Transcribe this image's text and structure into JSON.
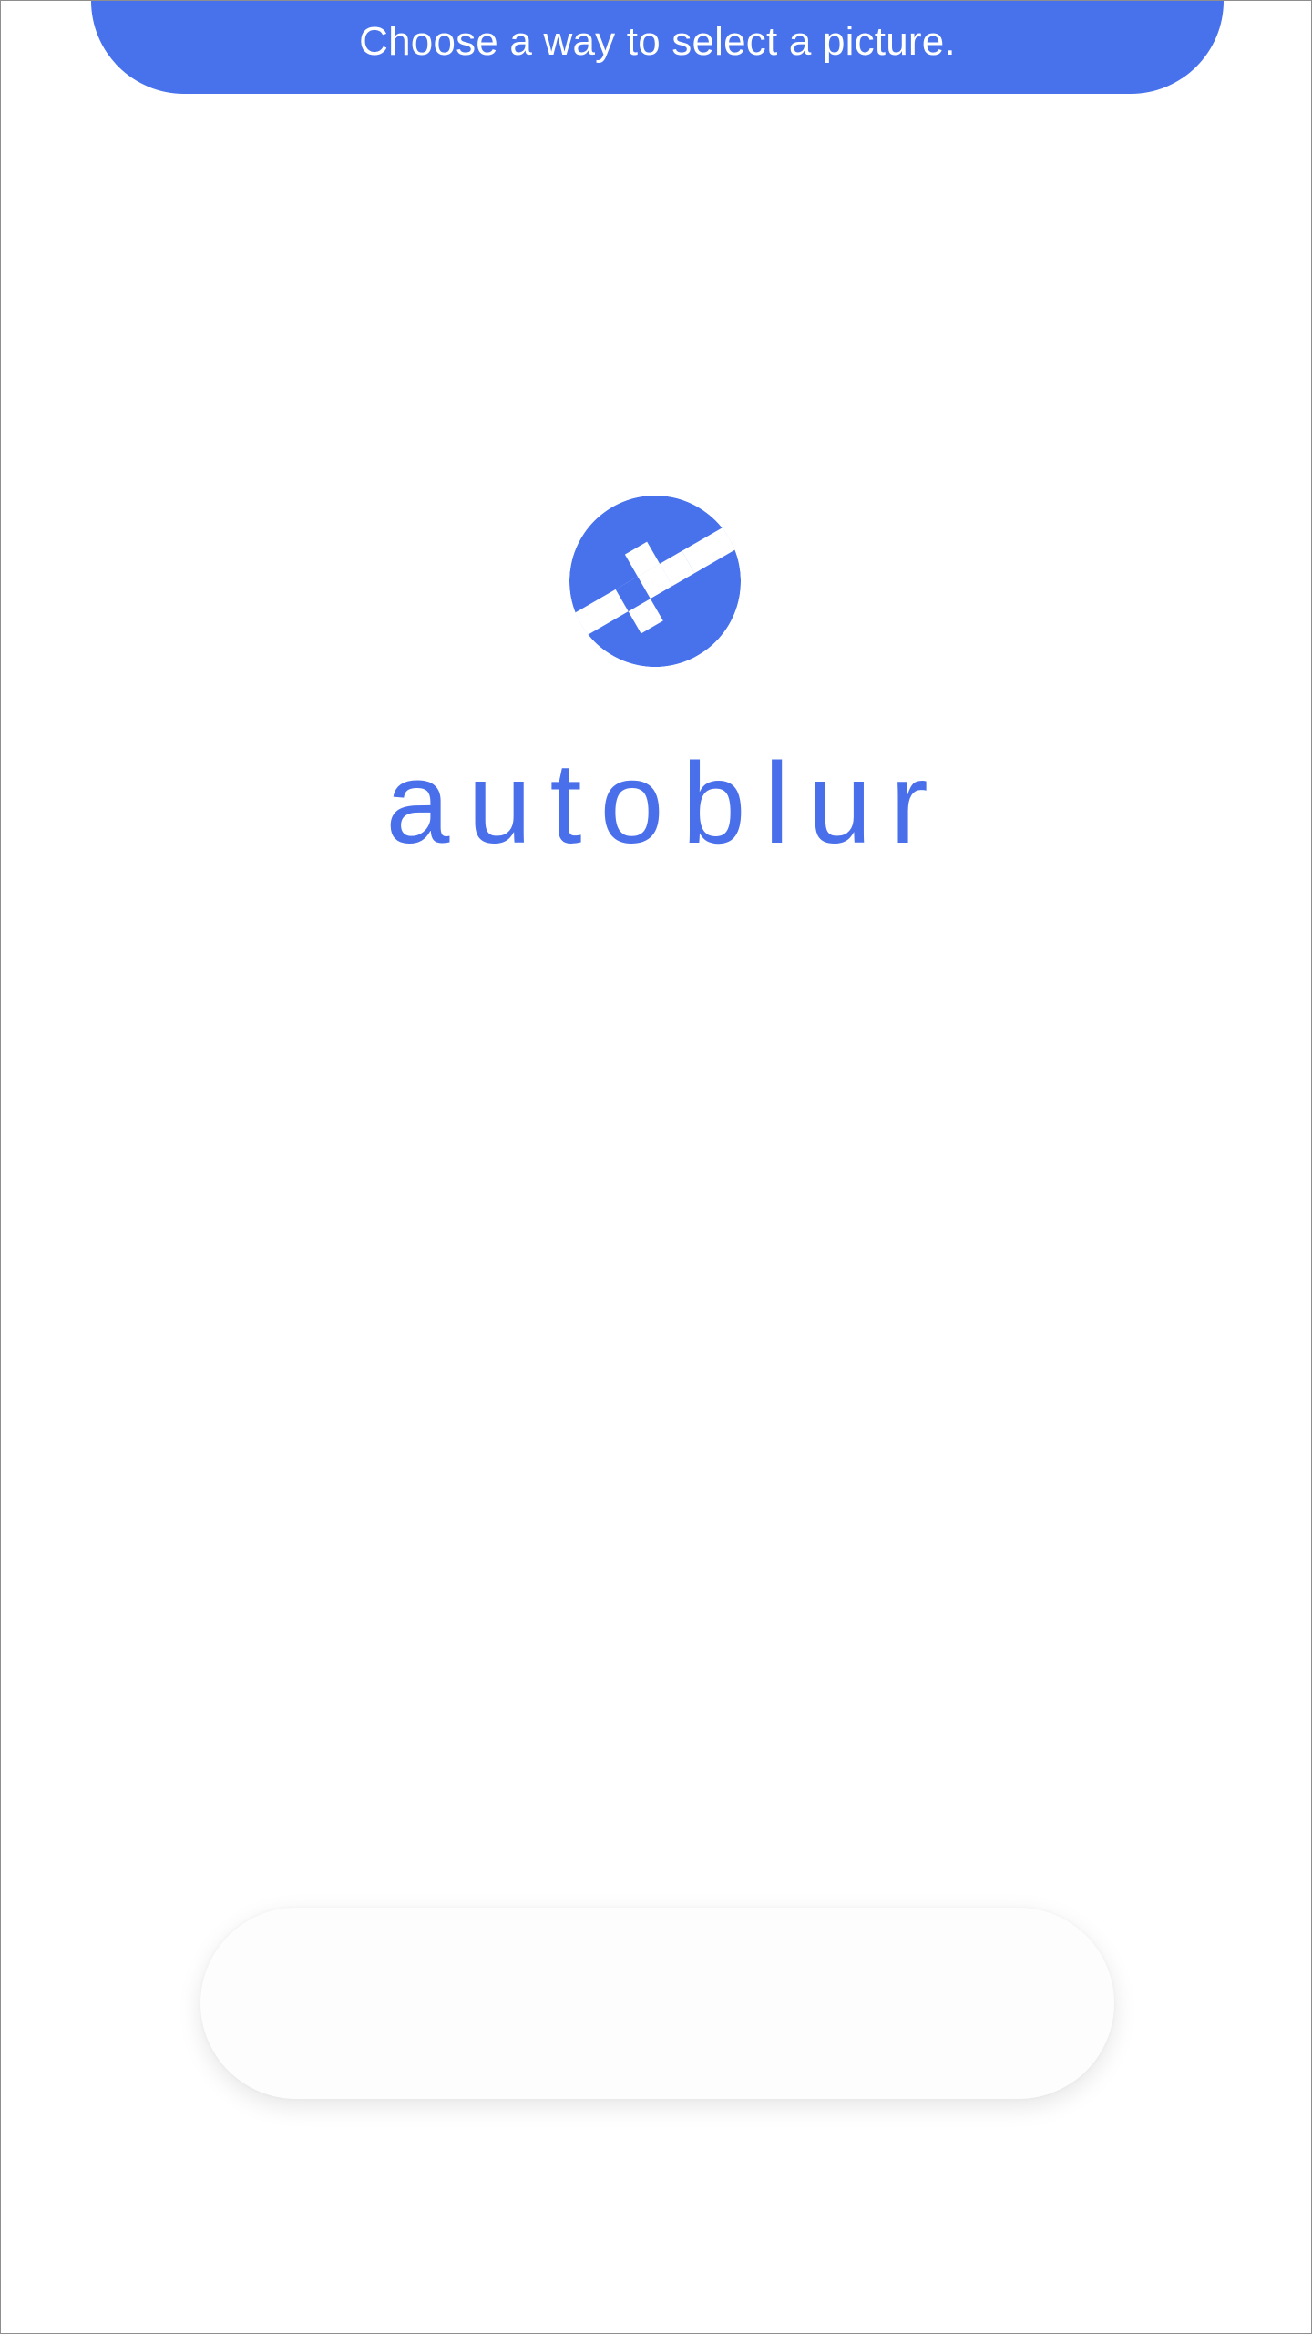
{
  "banner": {
    "text": "Choose a way to select a picture."
  },
  "brand": {
    "name": "autoblur",
    "logo_icon": "autoblur-logo-icon"
  },
  "colors": {
    "accent": "#4872ec",
    "background": "#ffffff"
  }
}
